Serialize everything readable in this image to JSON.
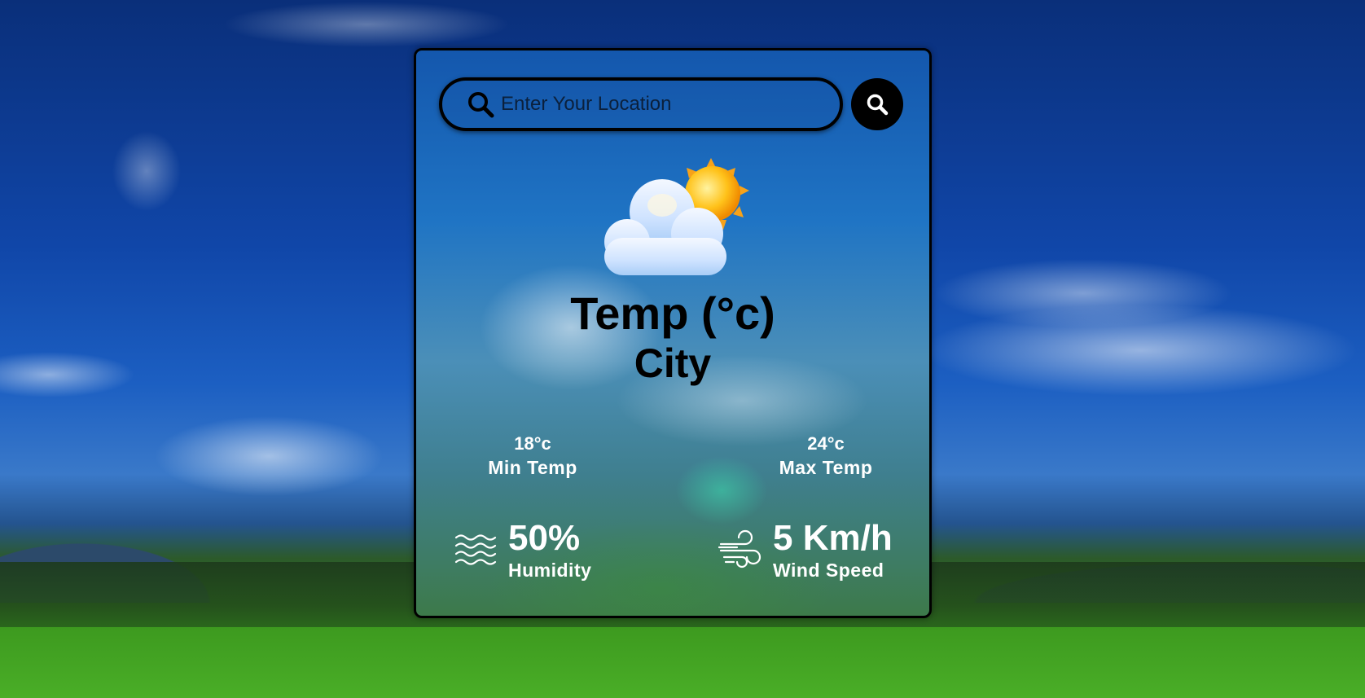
{
  "search": {
    "placeholder": "Enter Your Location",
    "value": ""
  },
  "weather": {
    "icon": "partly-cloudy-icon",
    "temp": "Temp (°c)",
    "city": "City",
    "min_temp": {
      "value": "18°c",
      "label": "Min Temp"
    },
    "max_temp": {
      "value": "24°c",
      "label": "Max Temp"
    },
    "humidity": {
      "value": "50%",
      "label": "Humidity",
      "icon": "waves-icon"
    },
    "wind": {
      "value": "5 Km/h",
      "label": "Wind Speed",
      "icon": "wind-icon"
    }
  },
  "colors": {
    "card_border": "#000000",
    "search_button": "#000000",
    "stat_text": "#ffffff",
    "heading_text": "#000000"
  }
}
